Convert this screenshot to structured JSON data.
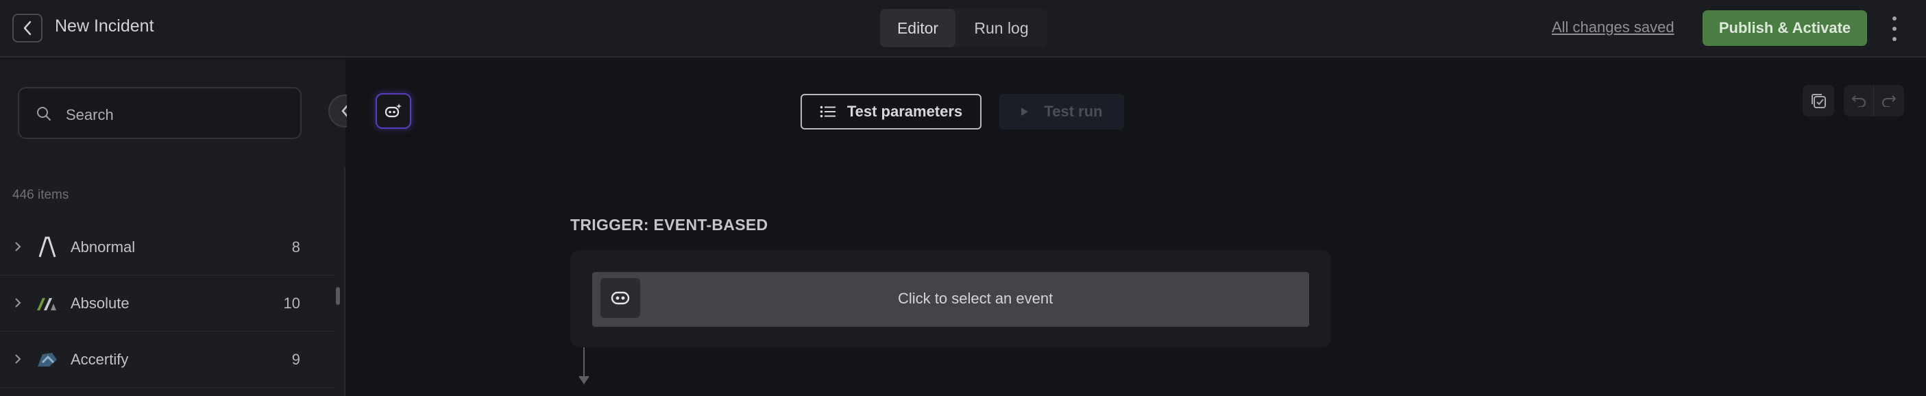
{
  "header": {
    "title": "New Incident",
    "tabs": [
      {
        "label": "Editor",
        "active": true
      },
      {
        "label": "Run log",
        "active": false
      }
    ],
    "save_status": "All changes saved",
    "publish_label": "Publish & Activate"
  },
  "sidebar": {
    "search": {
      "placeholder": "Search"
    },
    "item_count": "446 items",
    "items": [
      {
        "name": "Abnormal",
        "count": "8",
        "logo": "abnormal-logo"
      },
      {
        "name": "Absolute",
        "count": "10",
        "logo": "absolute-logo"
      },
      {
        "name": "Accertify",
        "count": "9",
        "logo": "accertify-logo"
      }
    ]
  },
  "toolbar": {
    "test_parameters_label": "Test parameters",
    "test_run_label": "Test run"
  },
  "trigger": {
    "label": "TRIGGER: EVENT-BASED",
    "event_placeholder": "Click to select an event"
  },
  "colors": {
    "publish": "#4a7d42",
    "ai_glow": "#5a3cc0",
    "background": "#131418"
  }
}
